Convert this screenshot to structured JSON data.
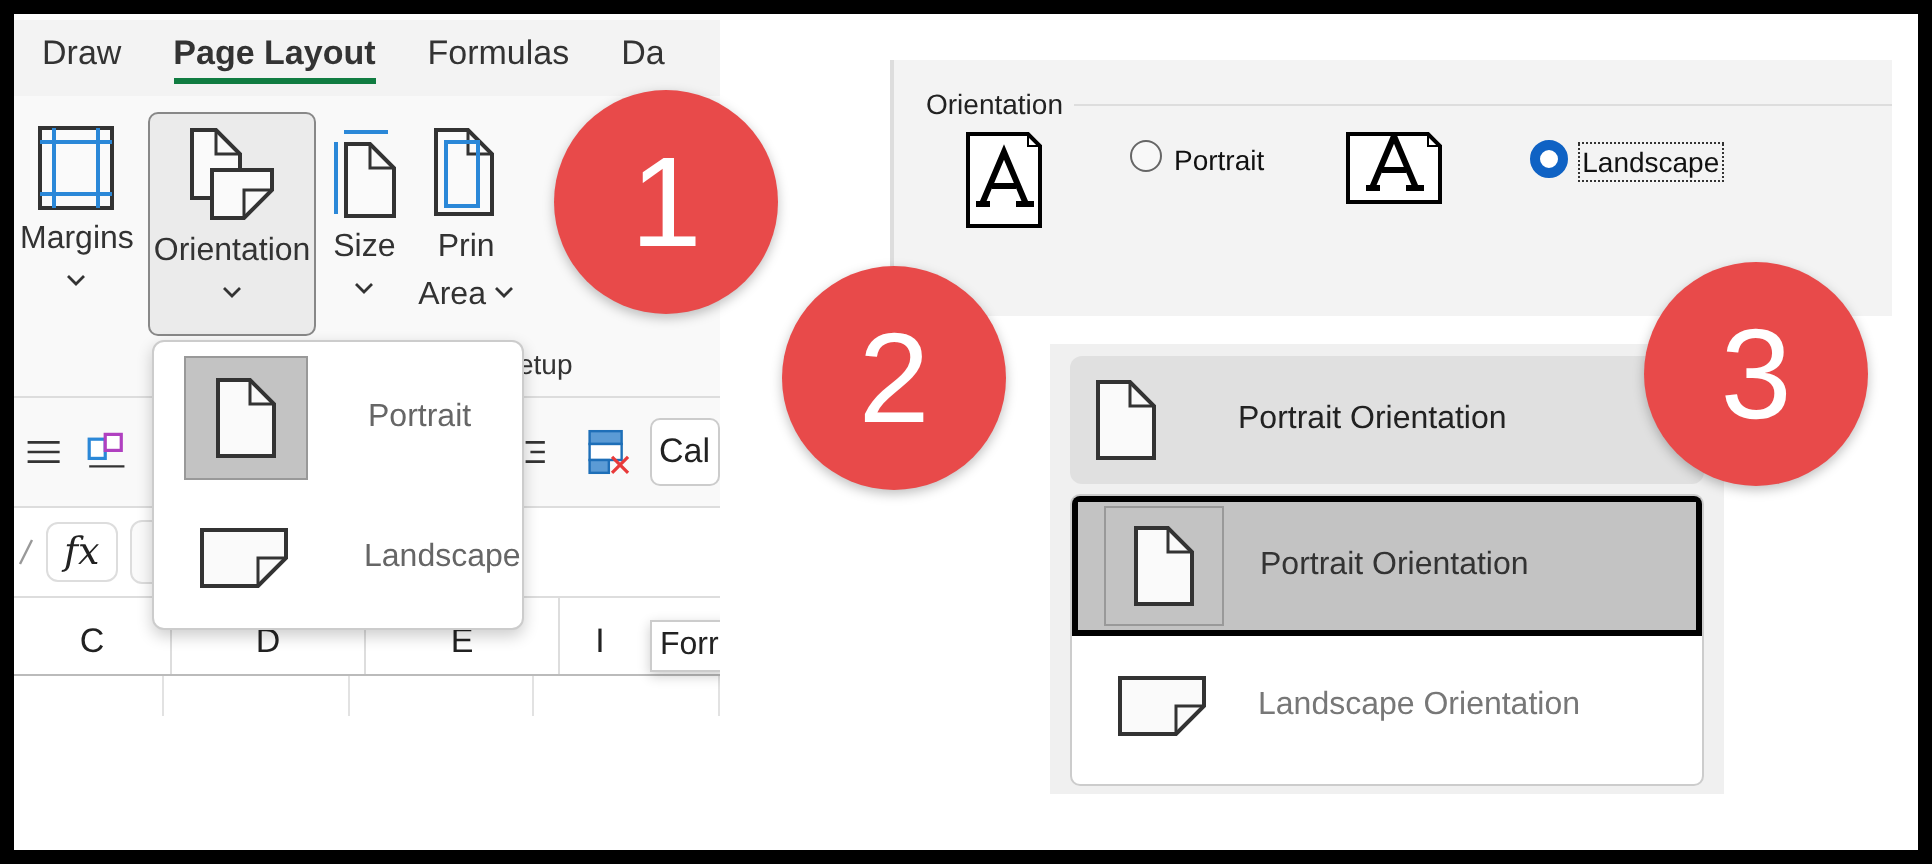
{
  "excel_ribbon": {
    "tabs": [
      {
        "label": "Draw",
        "selected": false
      },
      {
        "label": "Page Layout",
        "selected": true
      },
      {
        "label": "Formulas",
        "selected": false
      },
      {
        "label": "Da",
        "selected": false
      }
    ],
    "buttons": [
      {
        "kind": "margins",
        "label": "Margins",
        "selected": false
      },
      {
        "kind": "orientation",
        "label": "Orientation",
        "selected": true
      },
      {
        "kind": "size",
        "label": "Size",
        "selected": false
      },
      {
        "kind": "print_area",
        "label": "Prin",
        "label_2": "Area",
        "selected": false
      }
    ],
    "group_label": "etup",
    "font_field": "Cal",
    "formula_button": "fx",
    "columns": [
      "C",
      "D",
      "E",
      "I"
    ],
    "tooltip": "Forr",
    "orientation_menu": [
      {
        "kind": "portrait",
        "label": "Portrait",
        "selected": true
      },
      {
        "kind": "landscape",
        "label": "Landscape",
        "selected": false
      }
    ]
  },
  "page_setup_dialog": {
    "group_title": "Orientation",
    "options": [
      {
        "kind": "portrait",
        "label": "Portrait",
        "selected": false
      },
      {
        "kind": "landscape",
        "label": "Landscape",
        "selected": true
      }
    ]
  },
  "orientation_dropdown": {
    "current": "Portrait Orientation",
    "items": [
      {
        "kind": "portrait",
        "label": "Portrait Orientation",
        "selected": true
      },
      {
        "kind": "landscape",
        "label": "Landscape Orientation",
        "selected": false
      }
    ]
  },
  "callouts": [
    "1",
    "2",
    "3"
  ]
}
